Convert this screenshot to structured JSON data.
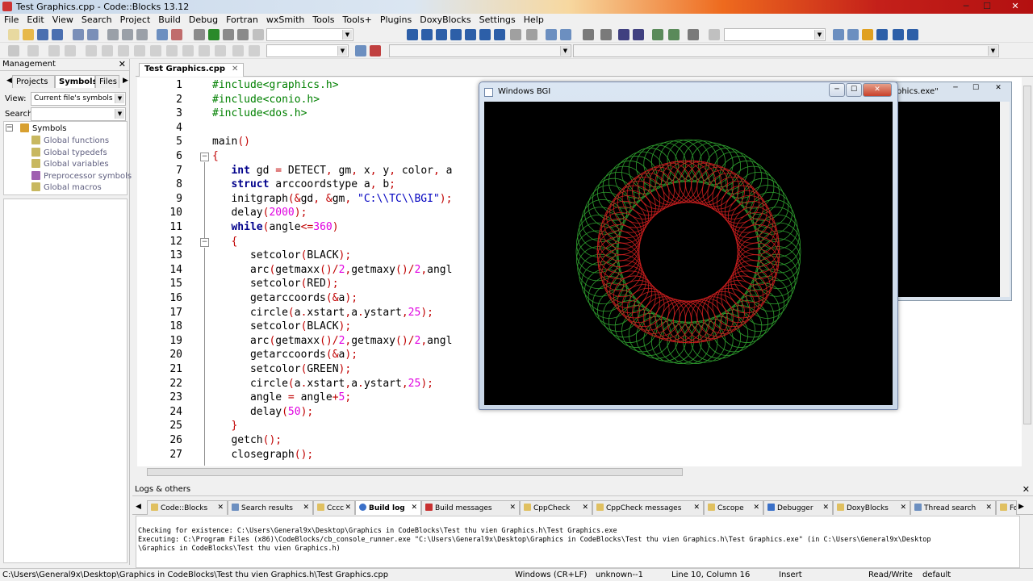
{
  "window": {
    "title": "Test Graphics.cpp - Code::Blocks 13.12",
    "min_label": "─",
    "max_label": "☐",
    "close_label": "✕"
  },
  "menu": [
    "File",
    "Edit",
    "View",
    "Search",
    "Project",
    "Build",
    "Debug",
    "Fortran",
    "wxSmith",
    "Tools",
    "Tools+",
    "Plugins",
    "DoxyBlocks",
    "Settings",
    "Help"
  ],
  "management": {
    "title": "Management",
    "tabs": [
      "Projects",
      "Symbols",
      "Files"
    ],
    "active_tab": "Symbols",
    "view_label": "View:",
    "view_value": "Current file's symbols",
    "search_label": "Search:",
    "search_value": "",
    "tree": {
      "root": "Symbols",
      "items": [
        "Global functions",
        "Global typedefs",
        "Global variables",
        "Preprocessor symbols",
        "Global macros"
      ]
    }
  },
  "editor": {
    "tab_label": "Test Graphics.cpp",
    "line_numbers": [
      "1",
      "2",
      "3",
      "4",
      "5",
      "6",
      "7",
      "8",
      "9",
      "10",
      "11",
      "12",
      "13",
      "14",
      "15",
      "16",
      "17",
      "18",
      "19",
      "20",
      "21",
      "22",
      "23",
      "24",
      "25",
      "26",
      "27"
    ],
    "lines": [
      "#include<graphics.h>",
      "#include<conio.h>",
      "#include<dos.h>",
      "",
      "main()",
      "{",
      "   int gd = DETECT, gm, x, y, color, a",
      "   struct arccoordstype a, b;",
      "   initgraph(&gd, &gm, \"C:\\\\TC\\\\BGI\");",
      "   delay(2000);",
      "   while(angle<=360)",
      "   {",
      "      setcolor(BLACK);",
      "      arc(getmaxx()/2,getmaxy()/2,angl",
      "      setcolor(RED);",
      "      getarccoords(&a);",
      "      circle(a.xstart,a.ystart,25);",
      "      setcolor(BLACK);",
      "      arc(getmaxx()/2,getmaxy()/2,angl",
      "      getarccoords(&a);",
      "      setcolor(GREEN);",
      "      circle(a.xstart,a.ystart,25);",
      "      angle = angle+5;",
      "      delay(50);",
      "   }",
      "   getch();",
      "   closegraph();"
    ]
  },
  "bgi_window": {
    "title": "Windows BGI",
    "colors": {
      "ring_green": "#2e9e2e",
      "ring_red": "#c81e1e"
    }
  },
  "console_window": {
    "title_fragment": "phics.exe\""
  },
  "logs": {
    "title": "Logs & others",
    "tabs": [
      "Code::Blocks",
      "Search results",
      "Cccc",
      "Build log",
      "Build messages",
      "CppCheck",
      "CppCheck messages",
      "Cscope",
      "Debugger",
      "DoxyBlocks",
      "Thread search",
      "Fo"
    ],
    "active_tab": "Build log",
    "lines": [
      "Checking for existence: C:\\Users\\General9x\\Desktop\\Graphics in CodeBlocks\\Test thu vien Graphics.h\\Test Graphics.exe",
      "Executing: C:\\Program Files (x86)\\CodeBlocks/cb_console_runner.exe \"C:\\Users\\General9x\\Desktop\\Graphics in CodeBlocks\\Test thu vien Graphics.h\\Test Graphics.exe\" (in C:\\Users\\General9x\\Desktop",
      "\\Graphics in CodeBlocks\\Test thu vien Graphics.h)"
    ]
  },
  "status": {
    "path": "C:\\Users\\General9x\\Desktop\\Graphics in CodeBlocks\\Test thu vien Graphics.h\\Test Graphics.cpp",
    "eol": "Windows (CR+LF)",
    "encoding": "unknown--1",
    "position": "Line 10, Column 16",
    "mode": "Insert",
    "access": "Read/Write",
    "lang": "default"
  }
}
